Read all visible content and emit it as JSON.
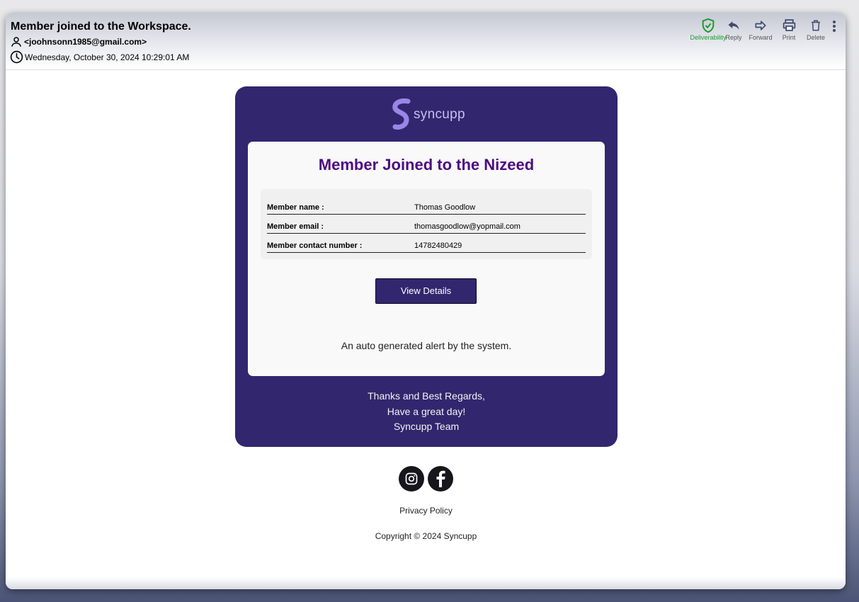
{
  "header": {
    "subject": "Member joined to the Workspace.",
    "sender": "<joohnsonn1985@gmail.com>",
    "date": "Wednesday, October 30, 2024 10:29:01 AM"
  },
  "toolbar": {
    "deliverability": "Deliverability",
    "reply": "Reply",
    "forward": "Forward",
    "print": "Print",
    "delete": "Delete"
  },
  "email": {
    "logo_text": "syncupp",
    "title": "Member Joined to the Nizeed",
    "details": [
      {
        "label": "Member name :",
        "value": "Thomas Goodlow"
      },
      {
        "label": "Member email :",
        "value": "thomasgoodlow@yopmail.com"
      },
      {
        "label": "Member contact number :",
        "value": "14782480429"
      }
    ],
    "button_label": "View Details",
    "auto_note": "An auto generated alert by the system.",
    "signoff": [
      "Thanks and Best Regards,",
      "Have a great day!",
      "Syncupp Team"
    ]
  },
  "footer": {
    "social": [
      "instagram-icon",
      "facebook-icon"
    ],
    "privacy": "Privacy Policy",
    "copyright": "Copyright © 2024 Syncupp"
  },
  "colors": {
    "brand_dark": "#32266e",
    "title_purple": "#4d0b82",
    "deliverability_green": "#1f9a2e"
  }
}
